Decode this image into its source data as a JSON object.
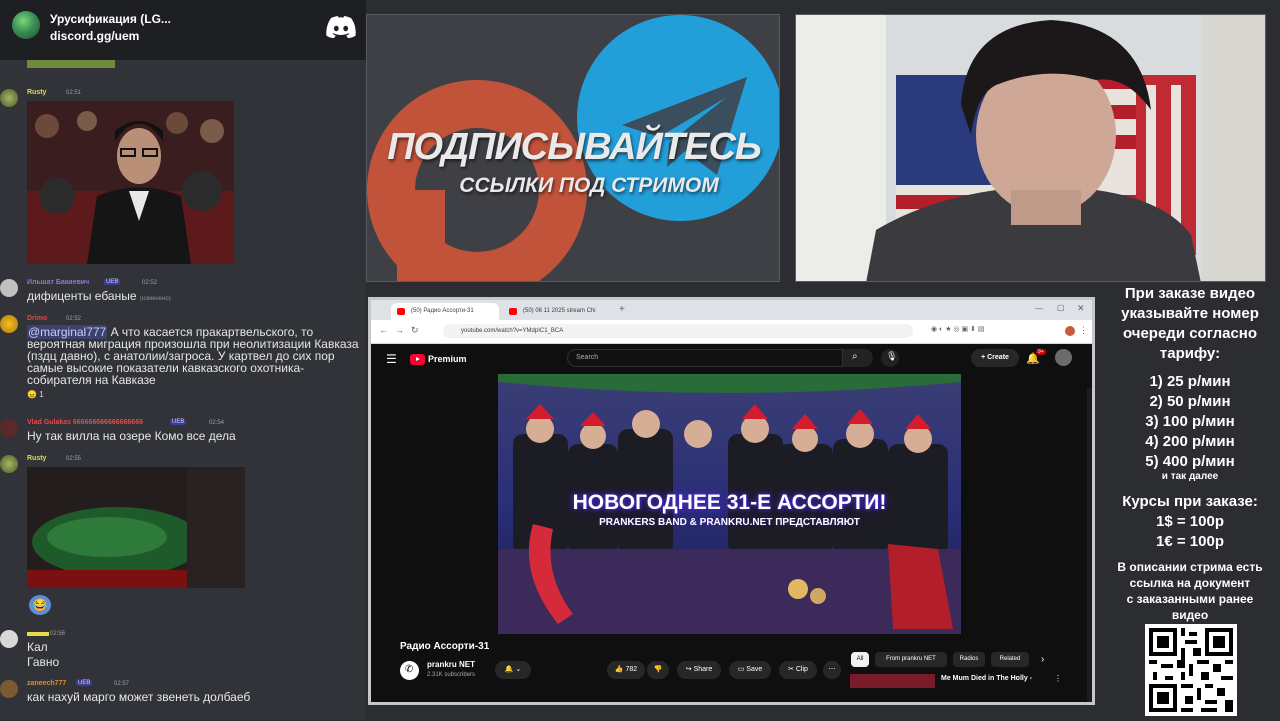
{
  "discord": {
    "server_name": "Урусификация (LG...",
    "invite": "discord.gg/uem",
    "messages": [
      {
        "user": "Rusty",
        "time": "02:51",
        "text": "",
        "has_image": true
      },
      {
        "user": "Ильшат Бакиевич",
        "badge": "UEB",
        "time": "02:52",
        "text": "дифиценты ебаные",
        "edited": "(изменено)"
      },
      {
        "user": "Drimo",
        "time": "02:52",
        "mention": "@marginal777",
        "text": " А что касается пракартвельского, то вероятная миграция произошла при неолитизации Кавказа (пздц давно), с анатолии/загроса. У картвел до сих пор самые высокие показатели кавказского охотника-собирателя на Кавказе",
        "reaction_count": "1"
      },
      {
        "user": "Vlad Gulakas 666666666666666666",
        "badge": "UEB",
        "time": "02:54",
        "text": "Ну так вилла на озере Комо все дела"
      },
      {
        "user": "Rusty",
        "time": "02:55",
        "text": "",
        "has_image": true
      },
      {
        "user": "",
        "time": "02:56",
        "text": "Кал",
        "text2": "Гавно"
      },
      {
        "user": "zaneech777",
        "badge": "UEB",
        "time": "02:57",
        "text": "как нахуй марго может звенеть долбаеб"
      }
    ]
  },
  "promo": {
    "title": "ПОДПИСЫВАЙТЕСЬ",
    "subtitle": "ССЫЛКИ ПОД СТРИМОМ"
  },
  "browser": {
    "tabs": [
      {
        "label": "(50) Радио Ассорти-31"
      },
      {
        "label": "(50) 06 11 2025 stream Chi"
      }
    ],
    "url": "youtube.com/watch?v=YMdpIC1_BCA",
    "youtube": {
      "brand": "Premium",
      "search_placeholder": "Search",
      "create_label": "Create",
      "notification_count": "9+",
      "thumbnail_title": "НОВОГОДНЕЕ 31-Е АССОРТИ!",
      "thumbnail_subtitle": "PRANKERS BAND & PRANKRU.NET ПРЕДСТАВЛЯЮТ",
      "video_title": "Радио Ассорти-31",
      "channel_name": "prankru NET",
      "subscribers": "2.31K subscribers",
      "likes": "782",
      "share_label": "Share",
      "save_label": "Save",
      "clip_label": "Clip",
      "chips": [
        "All",
        "From prankru NET",
        "Radios",
        "Related"
      ],
      "related_title": "Me Mum Died in The Holly -"
    }
  },
  "pricing": {
    "intro": [
      "При заказе видео",
      "указывайте номер",
      "очереди согласно",
      "тарифу:"
    ],
    "tariffs": [
      "1) 25 р/мин",
      "2) 50 р/мин",
      "3) 100 р/мин",
      "4) 200 р/мин",
      "5) 400 р/мин"
    ],
    "etc": "и так далее",
    "rates_title": "Курсы при заказе:",
    "rates": [
      "1$ = 100р",
      "1€ = 100р"
    ],
    "doc_note": [
      "В описании стрима есть",
      "ссылка на документ",
      "с заказанными ранее",
      "видео"
    ]
  },
  "colors": {
    "discord_bg": "#313338",
    "youtube_red": "#ff0033",
    "telegram_blue": "#229ed9",
    "patreon_orange": "#c0533a"
  }
}
